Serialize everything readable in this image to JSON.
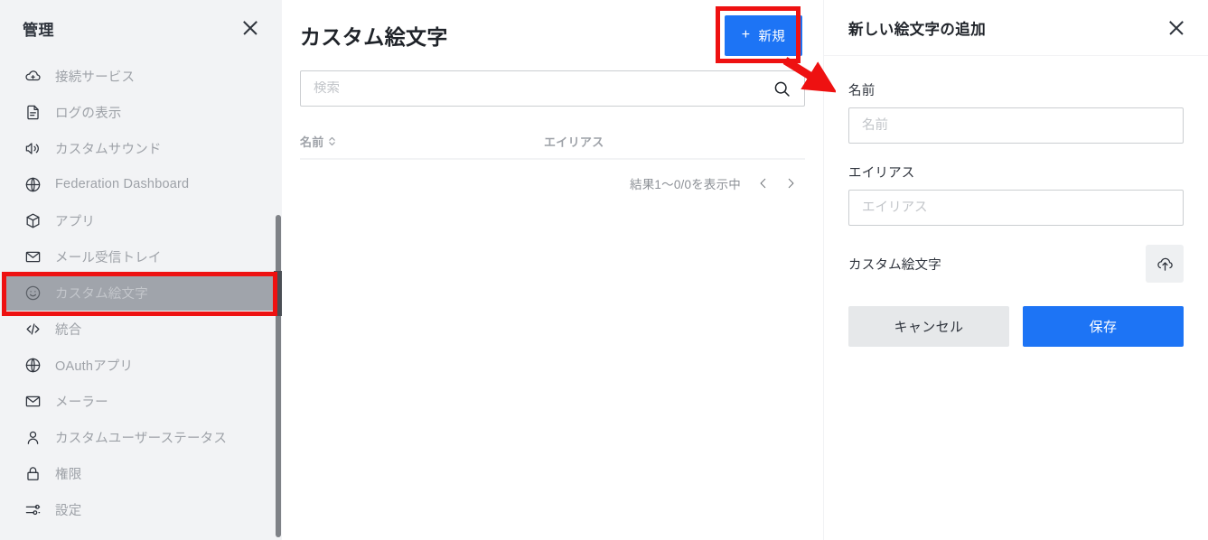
{
  "sidebar": {
    "title": "管理",
    "close_icon": "close-icon",
    "items": [
      {
        "label": "接続サービス",
        "icon": "cloud-plus-icon",
        "selected": false
      },
      {
        "label": "ログの表示",
        "icon": "document-icon",
        "selected": false
      },
      {
        "label": "カスタムサウンド",
        "icon": "speaker-icon",
        "selected": false
      },
      {
        "label": "Federation Dashboard",
        "icon": "globe-icon",
        "selected": false
      },
      {
        "label": "アプリ",
        "icon": "cube-icon",
        "selected": false
      },
      {
        "label": "メール受信トレイ",
        "icon": "envelope-icon",
        "selected": false
      },
      {
        "label": "カスタム絵文字",
        "icon": "smiley-icon",
        "selected": true
      },
      {
        "label": "統合",
        "icon": "code-icon",
        "selected": false
      },
      {
        "label": "OAuthアプリ",
        "icon": "globe-icon",
        "selected": false
      },
      {
        "label": "メーラー",
        "icon": "envelope-icon",
        "selected": false
      },
      {
        "label": "カスタムユーザーステータス",
        "icon": "person-icon",
        "selected": false
      },
      {
        "label": "権限",
        "icon": "lock-icon",
        "selected": false
      },
      {
        "label": "設定",
        "icon": "sliders-icon",
        "selected": false
      }
    ]
  },
  "main": {
    "title": "カスタム絵文字",
    "new_button": {
      "label": "新規",
      "plus": "+",
      "icon": "plus-icon"
    },
    "search": {
      "value": "",
      "placeholder": "検索",
      "icon": "search-icon"
    },
    "table": {
      "columns": [
        {
          "label": "名前",
          "sortable": true,
          "sort_icon": "sort-arrows-icon"
        },
        {
          "label": "エイリアス",
          "sortable": false
        }
      ],
      "rows": []
    },
    "pagination": {
      "summary": "結果1〜0/0を表示中",
      "prev_icon": "chevron-left-icon",
      "next_icon": "chevron-right-icon",
      "prev_label": "‹",
      "next_label": "›"
    }
  },
  "panel": {
    "title": "新しい絵文字の追加",
    "close_icon": "close-icon",
    "fields": [
      {
        "label": "名前",
        "value": "",
        "placeholder": "名前",
        "name": "name-field"
      },
      {
        "label": "エイリアス",
        "value": "",
        "placeholder": "エイリアス",
        "name": "alias-field"
      }
    ],
    "emoji_upload": {
      "label": "カスタム絵文字",
      "icon": "cloud-upload-icon"
    },
    "actions": {
      "cancel_label": "キャンセル",
      "save_label": "保存"
    }
  },
  "annotations": {
    "highlight_color": "#ee1111",
    "boxes": [
      {
        "name": "sidebar-custom-emoji-highlight"
      },
      {
        "name": "new-button-highlight"
      }
    ],
    "arrow": {
      "name": "pointer-arrow",
      "from": "new-button",
      "to": "panel"
    }
  },
  "colors": {
    "accent": "#1d74f5",
    "sidebar_bg": "#f2f3f5",
    "selected_bg": "#a0a4ab",
    "text": "#2f343d",
    "muted_text": "#9ea2a8",
    "highlight": "#ee1111"
  }
}
